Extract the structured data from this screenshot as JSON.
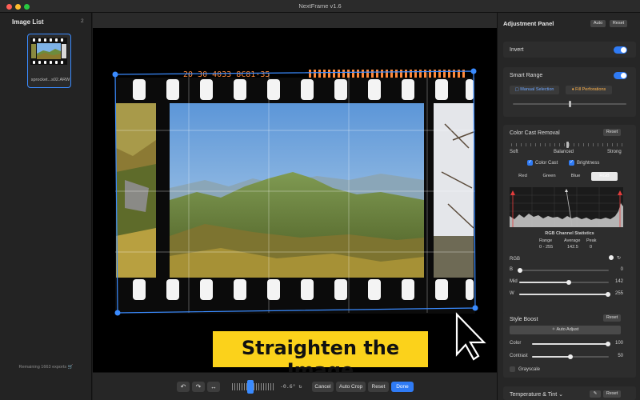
{
  "window": {
    "title": "NextFrame v1.6"
  },
  "sidebar": {
    "title": "Image List",
    "count": "2",
    "file_label": "sprocket...s02.ARW",
    "remaining": "Remaining 1663 exports"
  },
  "toolbar": {
    "rotate_left_icon": "rotate-left-icon",
    "rotate_right_icon": "rotate-right-icon",
    "flip_icon": "flip-horizontal-icon",
    "angle": "-0.6°",
    "cancel": "Cancel",
    "auto_crop": "Auto Crop",
    "reset": "Reset",
    "done": "Done"
  },
  "overlay": {
    "caption": "Straighten the Image"
  },
  "film": {
    "edge_code": "20 30 4033 8C81-35"
  },
  "panel": {
    "title": "Adjustment Panel",
    "auto": "Auto",
    "reset": "Reset",
    "invert": {
      "label": "Invert",
      "on": true
    },
    "smart_range": {
      "label": "Smart Range",
      "on": true,
      "manual": "Manual Selection",
      "fill": "Fill Perforations",
      "level": 0.5
    },
    "color_cast": {
      "title": "Color Cast Removal",
      "reset": "Reset",
      "soft": "Soft",
      "balanced": "Balanced",
      "strong": "Strong",
      "level": 0.5,
      "cast_label": "Color Cast",
      "brightness_label": "Brightness",
      "channels": [
        "Red",
        "Green",
        "Blue",
        "RGB"
      ],
      "active_channel": "RGB",
      "stats_title": "RGB Channel Statistics",
      "stats_headers": [
        "Range",
        "Average",
        "Peak"
      ],
      "stats_values": [
        "0 - 255",
        "142.5",
        "0"
      ],
      "rgb_label": "RGB",
      "b_label": "B",
      "b_value": "0",
      "mid_label": "Mid",
      "mid_value": "142",
      "w_label": "W",
      "w_value": "255"
    },
    "style_boost": {
      "title": "Style Boost",
      "reset": "Reset",
      "auto_adjust": "Auto Adjust",
      "color_label": "Color",
      "color_value": "100",
      "contrast_label": "Contrast",
      "contrast_value": "50",
      "grayscale_label": "Grayscale"
    },
    "temperature": {
      "title": "Temperature & Tint",
      "reset": "Reset"
    }
  },
  "colors": {
    "accent": "#2f7bf5",
    "banner": "#fbd21b"
  }
}
